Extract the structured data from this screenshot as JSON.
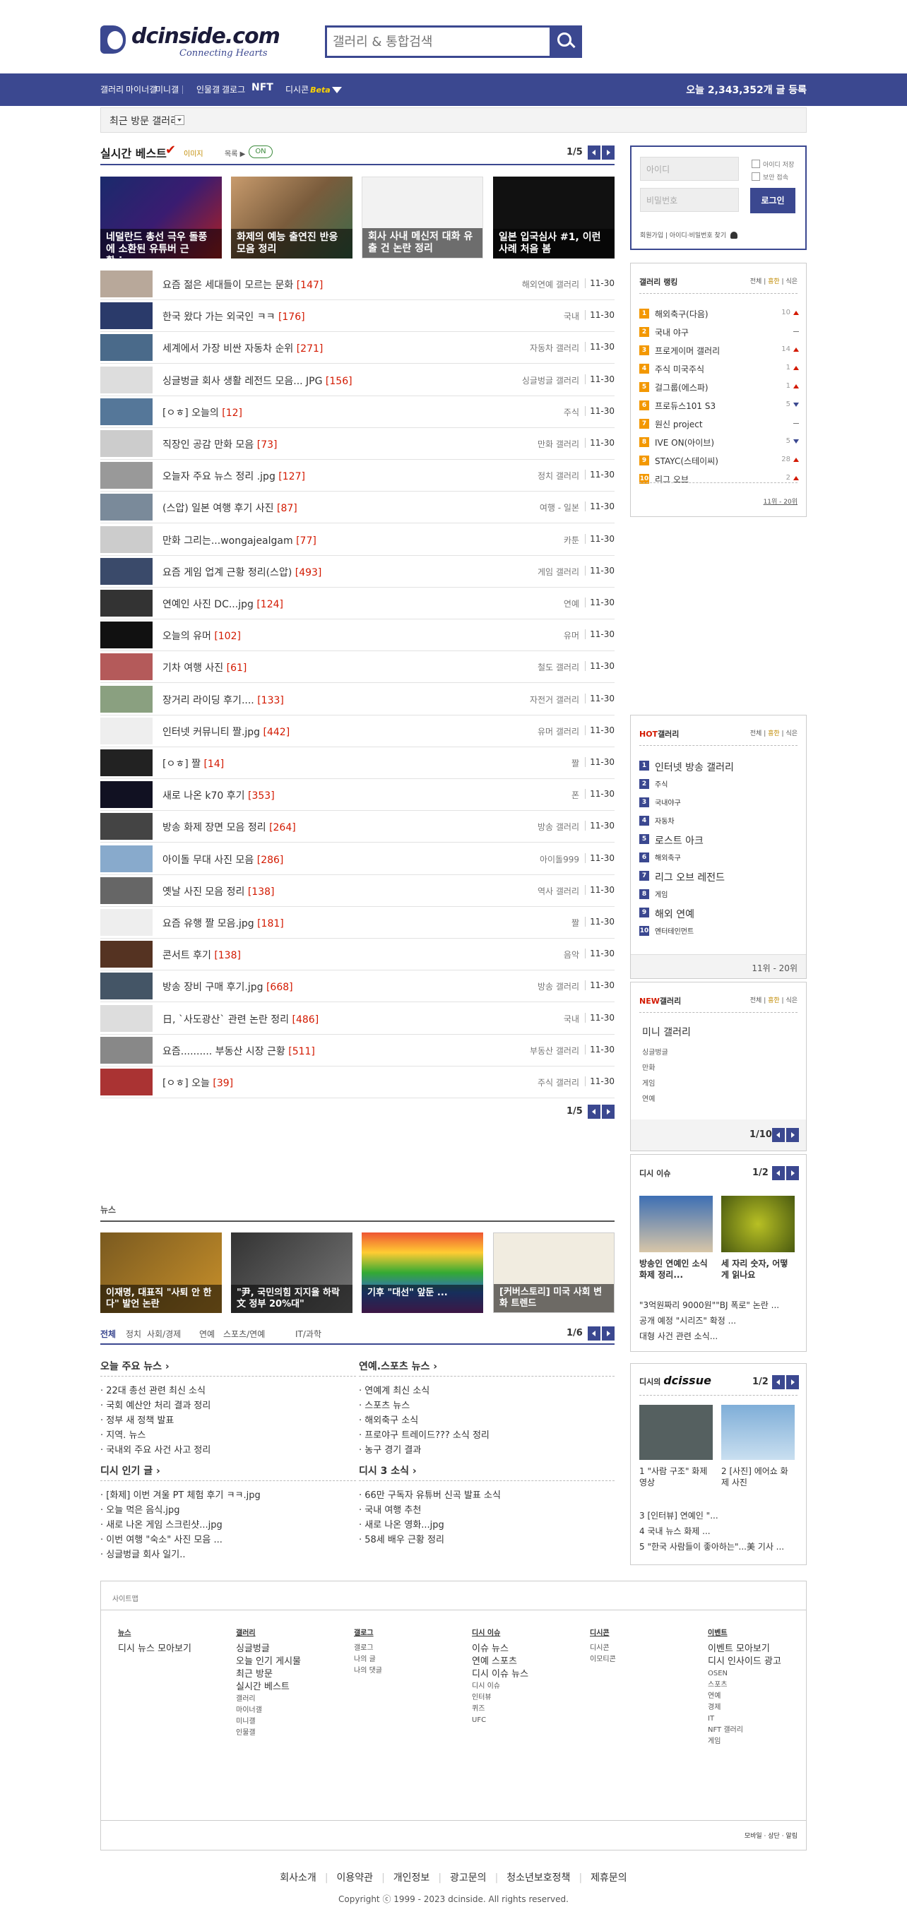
{
  "header": {
    "logo_text": "dcinside.com",
    "logo_sub": "Connecting Hearts",
    "search_placeholder": "갤러리 & 통합검색"
  },
  "gnb": {
    "items": [
      "갤러리",
      "마이너갤",
      "미니갤",
      "인물갤",
      "갤로그",
      "NFT",
      "디시콘"
    ],
    "beta": "Beta",
    "count_text": "오늘 2,343,352개 글 등록"
  },
  "subbar": {
    "label": "최근 방문 갤러리"
  },
  "hit": {
    "title": "실시간 베스트",
    "opt1": "이미지",
    "opt2": "목록",
    "toggle": "ON",
    "page": "1/5",
    "thumbs": [
      {
        "caption": "네덜란드 총선 극우 돌풍에 소환된 유튜버 근황.jpg"
      },
      {
        "caption": "화제의 예능 출연진 반응 모음 정리"
      },
      {
        "caption": "회사 사내 메신저 대화 유출 건 논란 정리"
      },
      {
        "caption": "일본 입국심사 #1, 이런 사례 처음 봄"
      }
    ],
    "rows": [
      {
        "title": "요즘 젊은 세대들이 모르는 문화",
        "count": "[147]",
        "gallery": "해외연예 갤러리",
        "date": "11-30"
      },
      {
        "title": "한국 왔다 가는 외국인 ㅋㅋ",
        "count": "[176]",
        "gallery": "국내",
        "date": "11-30"
      },
      {
        "title": "세계에서 가장 비싼 자동차 순위",
        "count": "[271]",
        "gallery": "자동차 갤러리",
        "date": "11-30"
      },
      {
        "title": "싱글벙글 회사 생활 레전드 모음... JPG",
        "count": "[156]",
        "gallery": "싱글벙글 갤러리",
        "date": "11-30"
      },
      {
        "title": "[ㅇㅎ] 오늘의",
        "count": "[12]",
        "gallery": "주식",
        "date": "11-30"
      },
      {
        "title": "직장인 공감 만화 모음",
        "count": "[73]",
        "gallery": "만화 갤러리",
        "date": "11-30"
      },
      {
        "title": "오늘자 주요 뉴스 정리 .jpg",
        "count": "[127]",
        "gallery": "정치 갤러리",
        "date": "11-30"
      },
      {
        "title": "(스압) 일본 여행 후기 사진",
        "count": "[87]",
        "gallery": "여행 - 일본",
        "date": "11-30"
      },
      {
        "title": "만화 그리는...wongajealgam",
        "count": "[77]",
        "gallery": "카툰",
        "date": "11-30"
      },
      {
        "title": "요즘 게임 업계 근황 정리(스압)",
        "count": "[493]",
        "gallery": "게임 갤러리",
        "date": "11-30"
      },
      {
        "title": "연예인 사진 DC...jpg",
        "count": "[124]",
        "gallery": "연예",
        "date": "11-30"
      },
      {
        "title": "오늘의 유머",
        "count": "[102]",
        "gallery": "유머",
        "date": "11-30"
      },
      {
        "title": "기차 여행 사진",
        "count": "[61]",
        "gallery": "철도 갤러리",
        "date": "11-30"
      },
      {
        "title": "장거리 라이딩 후기....",
        "count": "[133]",
        "gallery": "자전거 갤러리",
        "date": "11-30"
      },
      {
        "title": "인터넷 커뮤니티 짤.jpg",
        "count": "[442]",
        "gallery": "유머 갤러리",
        "date": "11-30"
      },
      {
        "title": "[ㅇㅎ] 짤",
        "count": "[14]",
        "gallery": "짤",
        "date": "11-30"
      },
      {
        "title": "새로 나온 k70 후기",
        "count": "[353]",
        "gallery": "폰",
        "date": "11-30"
      },
      {
        "title": "방송 화제 장면 모음 정리",
        "count": "[264]",
        "gallery": "방송 갤러리",
        "date": "11-30"
      },
      {
        "title": "아이돌 무대 사진 모음",
        "count": "[286]",
        "gallery": "아이돌999",
        "date": "11-30"
      },
      {
        "title": "옛날 사진 모음 정리",
        "count": "[138]",
        "gallery": "역사 갤러리",
        "date": "11-30"
      },
      {
        "title": "요즘 유행 짤 모음.jpg",
        "count": "[181]",
        "gallery": "짤",
        "date": "11-30"
      },
      {
        "title": "콘서트 후기",
        "count": "[138]",
        "gallery": "음악",
        "date": "11-30"
      },
      {
        "title": "방송 장비 구매 후기.jpg",
        "count": "[668]",
        "gallery": "방송 갤러리",
        "date": "11-30"
      },
      {
        "title": "日, `사도광산` 관련 논란 정리",
        "count": "[486]",
        "gallery": "국내",
        "date": "11-30"
      },
      {
        "title": "요즘.......... 부동산 시장 근황",
        "count": "[511]",
        "gallery": "부동산 갤러리",
        "date": "11-30"
      },
      {
        "title": "[ㅇㅎ] 오늘",
        "count": "[39]",
        "gallery": "주식 갤러리",
        "date": "11-30"
      }
    ],
    "page_bottom": "1/5"
  },
  "login": {
    "id_placeholder": "아이디",
    "pw_placeholder": "비밀번호",
    "save": "아이디 저장",
    "sec": "보안 접속",
    "button": "로그인",
    "links": "회원가입 | 아이디·비밀번호 찾기"
  },
  "ranking": {
    "title": "갤러리 랭킹",
    "opts": [
      "전체",
      "흥한",
      "식은"
    ],
    "items": [
      {
        "n": "1",
        "name": "해외축구(다음)",
        "v": "10",
        "t": "up"
      },
      {
        "n": "2",
        "name": "국내 야구",
        "v": "",
        "t": "eq"
      },
      {
        "n": "3",
        "name": "프로게이머 갤러리",
        "v": "14",
        "t": "up"
      },
      {
        "n": "4",
        "name": "주식 미국주식",
        "v": "1",
        "t": "up"
      },
      {
        "n": "5",
        "name": "걸그룹(에스파)",
        "v": "1",
        "t": "up"
      },
      {
        "n": "6",
        "name": "프로듀스101 S3",
        "v": "5",
        "t": "dn"
      },
      {
        "n": "7",
        "name": "원신 project",
        "v": "",
        "t": "eq"
      },
      {
        "n": "8",
        "name": "IVE ON(아이브)",
        "v": "5",
        "t": "dn"
      },
      {
        "n": "9",
        "name": "STAYC(스테이씨)",
        "v": "28",
        "t": "up"
      },
      {
        "n": "10",
        "name": "리그 오브",
        "v": "2",
        "t": "up"
      }
    ],
    "more": "11위 - 20위"
  },
  "hot": {
    "title": "HOT갤러리",
    "hot_label": "HOT",
    "items": [
      "인터넷 방송 갤러리",
      "주식",
      "국내야구",
      "자동차",
      "로스트 아크",
      "해외축구",
      "리그 오브 레전드",
      "게임",
      "해외 연예",
      "엔터테인먼트"
    ],
    "more": "11위 - 20위"
  },
  "newg": {
    "title": "NEW갤러리",
    "new_label": "NEW",
    "items": [
      "미니 갤러리",
      "싱글벙글",
      "만화",
      "게임",
      "연예"
    ],
    "page": "1/10"
  },
  "issue": {
    "title": "디시 이슈",
    "page": "1/2",
    "cards": [
      {
        "caption": "방송인 연예인 소식 화제 정리..."
      },
      {
        "caption": "세 자리 숫자, 어떻게 읽나요"
      }
    ],
    "lines": [
      "\"3억원짜리 9000원\"\"BJ 폭로\" 논란 ...",
      "공개 예정 \"시리즈\" 확정 ...",
      "대형 사건 관련 소식..."
    ]
  },
  "dcissue": {
    "prefix": "디시의",
    "brand": "dcissue",
    "page": "1/2",
    "cap1": "1 \"사람 구조\" 화제 영상",
    "cap2": "2 [사진] 에어쇼 화제 사진",
    "lines": [
      "3 [인터뷰] 연예인 \"...",
      "4 국내 뉴스 화제 ...",
      "5 \"한국 사람들이 좋아하는\"...美 기사 ..."
    ]
  },
  "news": {
    "title": "뉴스",
    "cards": [
      {
        "caption": "이재명, 대표직 \"사퇴 안 한다\" 발언 논란"
      },
      {
        "caption": "\"尹, 국민의힘 지지율 하락 文 정부 20%대\""
      },
      {
        "caption": "기후 \"대선\" 앞둔 ..."
      },
      {
        "caption": "[커버스토리] 미국 사회 변화 트렌드"
      }
    ],
    "tabs": [
      "전체",
      "정치",
      "사회/경제",
      "연예",
      "스포츠/연예",
      "IT/과학"
    ],
    "page": "1/6",
    "blocks": [
      {
        "head": "오늘 주요 뉴스",
        "items": [
          "22대 총선 관련 최신 소식",
          "국회 예산안 처리 결과 정리",
          "정부 새 정책 발표",
          "지역. 뉴스",
          "국내외 주요 사건 사고 정리"
        ]
      },
      {
        "head": "연예.스포츠 뉴스",
        "items": [
          "연예계 최신 소식",
          "스포츠 뉴스",
          "해외축구 소식",
          "프로야구 트레이드??? 소식 정리",
          "농구 경기 결과"
        ]
      },
      {
        "head": "디시 인기 글",
        "items": [
          "[화제] 이번 겨울 PT 체험 후기 ㅋㅋ.jpg",
          "오늘 먹은 음식.jpg",
          "새로 나온 게임 스크린샷...jpg",
          "이번 여행 \"숙소\" 사진 모음 ...",
          "싱글벙글 회사 일기.."
        ]
      },
      {
        "head": "디시 3 소식",
        "items": [
          "66만 구독자 유튜버 신곡 발표 소식",
          "국내 여행 추천",
          "새로 나온 영화...jpg",
          "58세 배우 근황 정리"
        ]
      }
    ]
  },
  "footer": {
    "sitemap_title": "사이트맵",
    "cols": [
      {
        "title": "뉴스",
        "links": [],
        "big": [
          "디시 뉴스 모아보기"
        ]
      },
      {
        "title": "갤러리",
        "links": [
          "갤러리",
          "마이너갤",
          "미니갤",
          "인물갤"
        ],
        "big": [
          "싱글벙글",
          "오늘 인기 게시물",
          "최근 방문",
          "실시간 베스트"
        ]
      },
      {
        "title": "갤로그",
        "links": [
          "갤로그",
          "나의 글",
          "나의 댓글"
        ],
        "big": []
      },
      {
        "title": "디시 이슈",
        "links": [
          "디시 이슈",
          "인터뷰",
          "퀴즈"
        ],
        "big": [
          "이슈 뉴스",
          "연예 스포츠",
          "디시 이슈 뉴스"
        ],
        "extra": "UFC"
      },
      {
        "title": "디시콘",
        "links": [
          "디시콘",
          "이모티콘"
        ],
        "big": []
      },
      {
        "title": "이벤트",
        "links": [
          "OSEN",
          "스포츠",
          "연예",
          "경제",
          "IT",
          "NFT 갤러리",
          "게임"
        ],
        "big": [
          "이벤트 모아보기",
          "디시 인사이드 광고"
        ]
      }
    ],
    "bottom_links": [
      "회사소개",
      "이용약관",
      "개인정보",
      "광고문의",
      "청소년보호정책",
      "제휴문의"
    ],
    "tools": "모바일 · 상단 · 알림",
    "copyright": "Copyright ⓒ 1999 - 2023 dcinside. All rights reserved."
  }
}
